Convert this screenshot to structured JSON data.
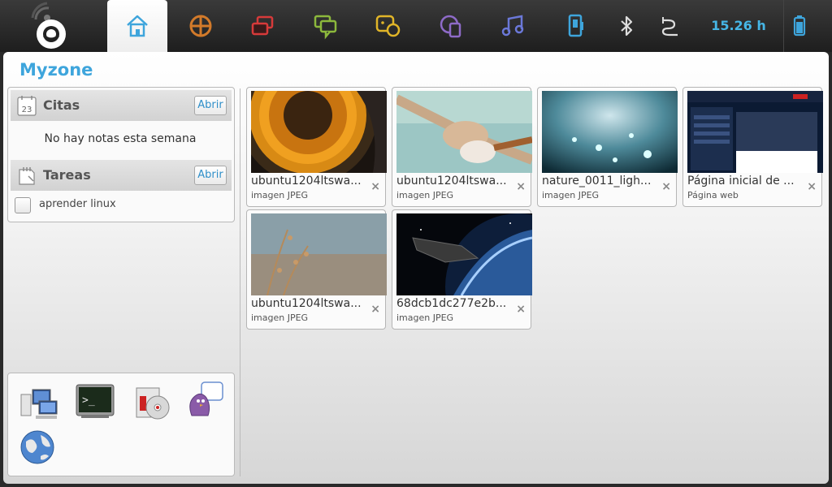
{
  "clock": "15.26 h",
  "zone": {
    "title": "Myzone"
  },
  "appointments": {
    "label": "Citas",
    "open": "Abrir",
    "calendar_day": "23",
    "empty": "No hay notas esta semana"
  },
  "tasks": {
    "label": "Tareas",
    "open": "Abrir",
    "items": [
      {
        "text": "aprender linux",
        "done": false
      }
    ]
  },
  "recent": [
    {
      "name": "ubuntu1204ltswa...",
      "type": "imagen JPEG",
      "close": "×"
    },
    {
      "name": "ubuntu1204ltswa...",
      "type": "imagen JPEG",
      "close": "×"
    },
    {
      "name": "nature_0011_ligh...",
      "type": "imagen JPEG",
      "close": "×"
    },
    {
      "name": "Página inicial de ...",
      "type": "Página web",
      "close": "×"
    },
    {
      "name": "ubuntu1204ltswa...",
      "type": "imagen JPEG",
      "close": "×"
    },
    {
      "name": "68dcb1dc277e2b...",
      "type": "imagen JPEG",
      "close": "×"
    }
  ],
  "colors": {
    "accent": "#3ea5dc",
    "clock": "#46b6e6"
  }
}
